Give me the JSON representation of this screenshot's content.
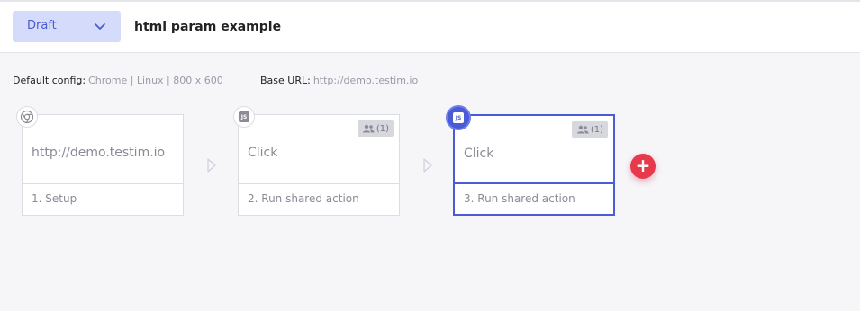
{
  "header": {
    "status": "Draft",
    "title": "html param example"
  },
  "config": {
    "default_label": "Default config:",
    "default_value": "Chrome | Linux | 800 x 600",
    "base_url_label": "Base URL:",
    "base_url_value": "http://demo.testim.io"
  },
  "steps": [
    {
      "body": "http://demo.testim.io",
      "footer": "1. Setup",
      "icon": "chrome-icon"
    },
    {
      "body": "Click",
      "footer": "2. Run shared action",
      "icon": "js-icon",
      "shared_count": "(1)"
    },
    {
      "body": "Click",
      "footer": "3. Run shared action",
      "icon": "js-icon",
      "shared_count": "(1)",
      "selected": true
    }
  ],
  "icons": {
    "js_label": "JS",
    "add": "+"
  },
  "colors": {
    "accent": "#4a5bd4",
    "status_bg": "#d5dbfb",
    "add_button": "#e7394c",
    "background": "#f6f6f9"
  }
}
